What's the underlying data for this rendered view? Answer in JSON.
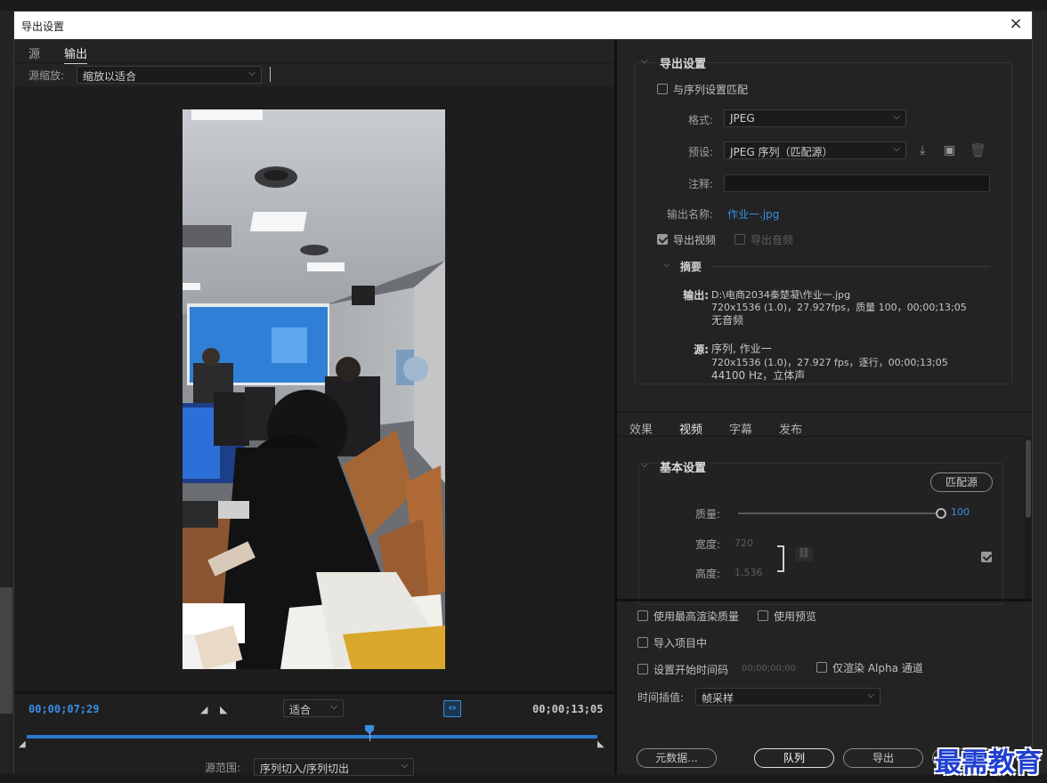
{
  "window": {
    "title": "导出设置",
    "close_icon": "×"
  },
  "left": {
    "tabs": [
      "源",
      "输出"
    ],
    "active_tab": "输出",
    "source_scaling_label": "源缩放:",
    "source_scaling_value": "缩放以适合",
    "current_time": "00;00;07;29",
    "fit_value": "适合",
    "duration": "00;00;13;05",
    "playhead_fraction": 0.6,
    "source_range_label": "源范围:",
    "source_range_value": "序列切入/序列切出"
  },
  "export_settings": {
    "header": "导出设置",
    "match_sequence": {
      "label": "与序列设置匹配",
      "checked": false
    },
    "format_label": "格式:",
    "format_value": "JPEG",
    "preset_label": "预设:",
    "preset_value": "JPEG 序列（匹配源）",
    "comments_label": "注释:",
    "comments_value": "",
    "output_name_label": "输出名称:",
    "output_name_value": "作业一.jpg",
    "export_video": {
      "label": "导出视频",
      "checked": true
    },
    "export_audio": {
      "label": "导出音频",
      "checked": false
    },
    "summary": {
      "header": "摘要",
      "output_label": "输出:",
      "output_lines": [
        "D:\\电商2034秦楚凝\\作业一.jpg",
        "720x1536 (1.0)，27.927fps，质量 100，00;00;13;05",
        "无音频"
      ],
      "source_label": "源:",
      "source_lines": [
        "序列, 作业一",
        "720x1536 (1.0)，27.927 fps，逐行，00;00;13;05",
        "44100 Hz，立体声"
      ]
    }
  },
  "tabs": {
    "items": [
      "效果",
      "视频",
      "字幕",
      "发布"
    ],
    "active": "视频"
  },
  "video": {
    "header": "基本设置",
    "match_source_button": "匹配源",
    "quality_label": "质量:",
    "quality_value": "100",
    "quality_fraction": 1.0,
    "width_label": "宽度:",
    "width_value": "720",
    "height_label": "高度:",
    "height_value": "1,536"
  },
  "bottom": {
    "max_render_quality": {
      "label": "使用最高渲染质量",
      "checked": false
    },
    "use_previews": {
      "label": "使用预览",
      "checked": false
    },
    "import_into_project": {
      "label": "导入项目中",
      "checked": false
    },
    "set_start_timecode": {
      "label": "设置开始时间码",
      "checked": false,
      "value": "00;00;00;00"
    },
    "render_alpha_only": {
      "label": "仅渲染 Alpha 通道",
      "checked": false
    },
    "time_interpolation_label": "时间插值:",
    "time_interpolation_value": "帧采样",
    "metadata_button": "元数据...",
    "queue_button": "队列",
    "export_button": "导出",
    "cancel_button": "取消"
  },
  "watermark": "最需教育",
  "colors": {
    "accent_blue": "#3a8ee6",
    "panel": "#232323",
    "title_bar": "#ffffff",
    "watermark": "#1f3fd0"
  }
}
